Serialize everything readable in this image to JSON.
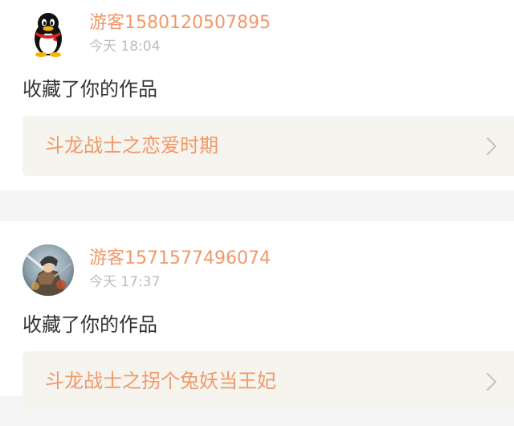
{
  "notifications": [
    {
      "avatar_icon": "qq-penguin-icon",
      "username": "游客1580120507895",
      "time": "今天 18:04",
      "message": "收藏了你的作品",
      "work_title": "斗龙战士之恋爱时期"
    },
    {
      "avatar_icon": "warrior-portrait-icon",
      "username": "游客1571577496074",
      "time": "今天 17:37",
      "message": "收藏了你的作品",
      "work_title": "斗龙战士之拐个兔妖当王妃"
    }
  ],
  "colors": {
    "accent": "#f0996a",
    "muted": "#bdbdbd",
    "text": "#333333",
    "link_bg": "#f5f4ee",
    "page_bg": "#f5f5f5"
  }
}
